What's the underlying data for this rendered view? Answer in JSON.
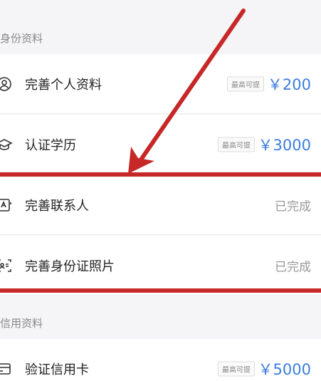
{
  "sections": [
    {
      "title": "身份资料"
    },
    {
      "title": "信用资料"
    }
  ],
  "rows": [
    {
      "label": "完善个人资料",
      "badge": "最高可提",
      "amount": "￥200",
      "icon": "user-circle-icon"
    },
    {
      "label": "认证学历",
      "badge": "最高可提",
      "amount": "￥3000",
      "icon": "graduation-cap-icon"
    },
    {
      "label": "完善联系人",
      "status": "已完成",
      "icon": "contact-card-icon"
    },
    {
      "label": "完善身份证照片",
      "status": "已完成",
      "icon": "id-card-scan-icon"
    },
    {
      "label": "验证信用卡",
      "badge": "最高可提",
      "amount": "￥5000",
      "icon": "credit-card-icon"
    }
  ],
  "colors": {
    "accent": "#3b7ddd",
    "annotation": "#c62828"
  }
}
